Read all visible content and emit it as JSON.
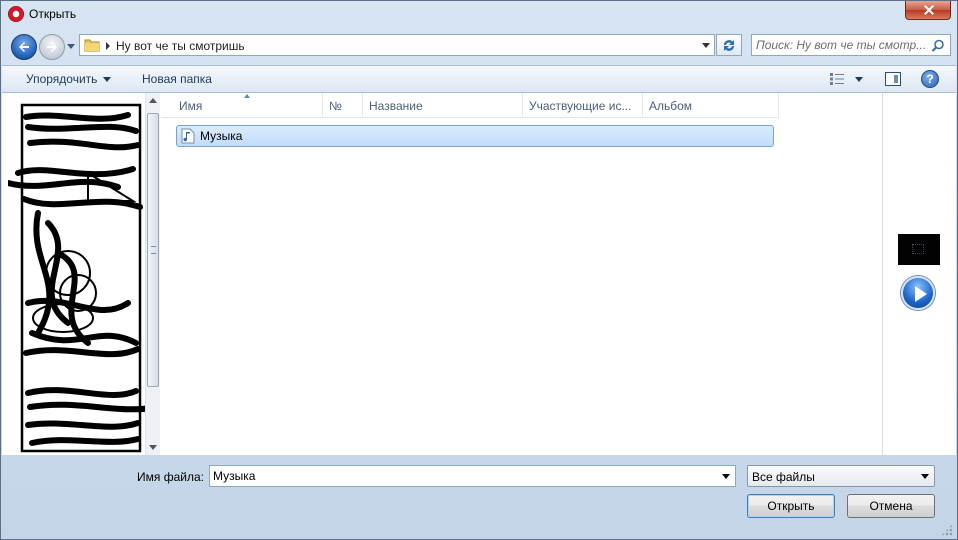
{
  "window": {
    "title": "Открыть",
    "close_label": "×"
  },
  "address_bar": {
    "path": "Ну вот че ты смотришь",
    "search_placeholder": "Поиск: Ну вот че ты смотр..."
  },
  "command_bar": {
    "organize_label": "Упорядочить",
    "new_folder_label": "Новая папка",
    "help_label": "?"
  },
  "file_list": {
    "columns": [
      "Имя",
      "№",
      "Название",
      "Участвующие ис...",
      "Альбом"
    ],
    "items": [
      {
        "name": "Музыка",
        "selected": true
      }
    ]
  },
  "bottom": {
    "filename_label": "Имя файла:",
    "filename_value": "Музыка",
    "filetype_value": "Все файлы",
    "open_label": "Открыть",
    "cancel_label": "Отмена"
  },
  "colors": {
    "accent": "#1d5fb5",
    "selection_fill": "#c1dcfc",
    "selection_border": "#7da2ce",
    "close_button": "#c95b47"
  }
}
